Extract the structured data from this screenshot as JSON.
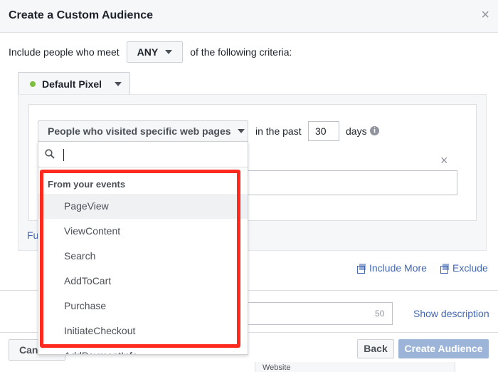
{
  "dialog": {
    "title": "Create a Custom Audience",
    "close_glyph": "×"
  },
  "criteria": {
    "prefix": "Include people who meet",
    "match_value": "ANY",
    "suffix": "of the following criteria:"
  },
  "pixel": {
    "label": "Default Pixel",
    "status_color": "#7cbf3f"
  },
  "rule": {
    "visit_type": "People who visited specific web pages",
    "in_the_past_label": "in the past",
    "days_value": "30",
    "days_label": "days",
    "info_glyph": "i",
    "remove_glyph": "×",
    "partial_link": "Fu"
  },
  "dropdown": {
    "search_value": "",
    "group_label": "From your events",
    "items": [
      {
        "label": "PageView"
      },
      {
        "label": "ViewContent"
      },
      {
        "label": "Search"
      },
      {
        "label": "AddToCart"
      },
      {
        "label": "Purchase"
      },
      {
        "label": "InitiateCheckout"
      },
      {
        "label": "AddPaymentInfo"
      }
    ]
  },
  "actions": {
    "include_more": "Include More",
    "exclude": "Exclude"
  },
  "audience_name": {
    "char_count": "50",
    "show_description": "Show description"
  },
  "footer": {
    "cancel": "Cancel",
    "back": "Back",
    "create": "Create Audience",
    "behind_text": "Website"
  },
  "colors": {
    "accent_link": "#4267b2",
    "highlight": "#ff2a1e",
    "create_disabled": "#9cb4d8"
  }
}
